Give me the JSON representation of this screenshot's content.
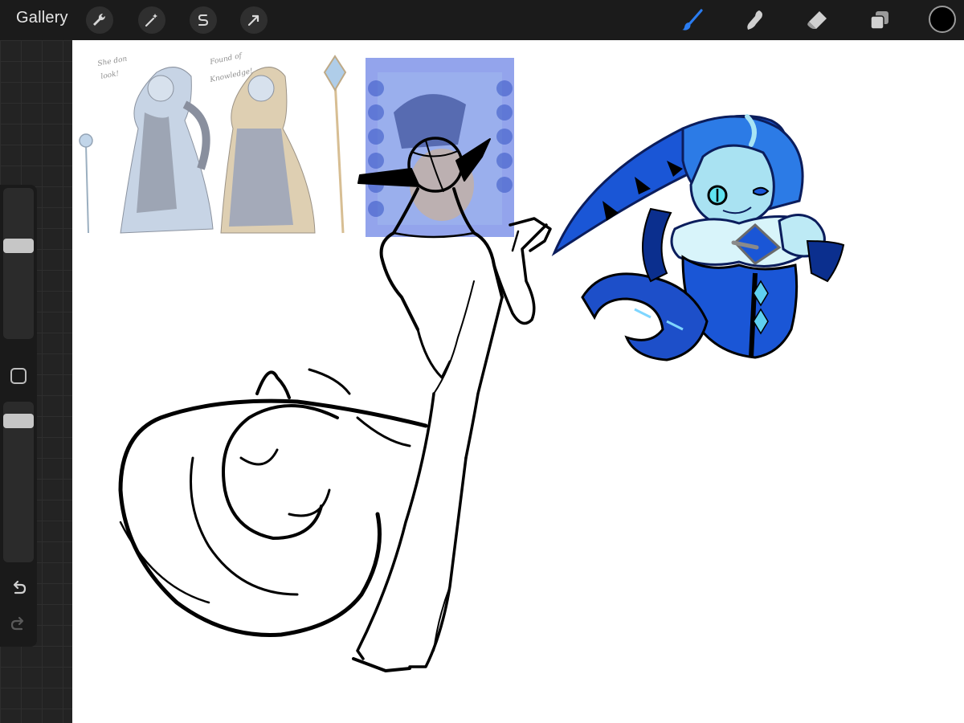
{
  "topbar": {
    "gallery_label": "Gallery",
    "left_tools": [
      "wrench-icon",
      "magic-wand-icon",
      "selection-s-icon",
      "transform-arrow-icon"
    ],
    "right_tools": [
      "brush-icon",
      "smudge-icon",
      "eraser-icon",
      "layers-icon"
    ],
    "active_tool": "brush-icon",
    "accent_color": "#1f6fd6",
    "current_color": "#000000"
  },
  "sidebar": {
    "brush_size_level": 0.42,
    "opacity_level": 0.58
  },
  "canvas": {
    "background": "#ffffff",
    "reference_card_color": "#6f86e6",
    "cookie_colors": [
      "#1a56d6",
      "#0b2f8e",
      "#9fe2f0",
      "#000000"
    ]
  }
}
